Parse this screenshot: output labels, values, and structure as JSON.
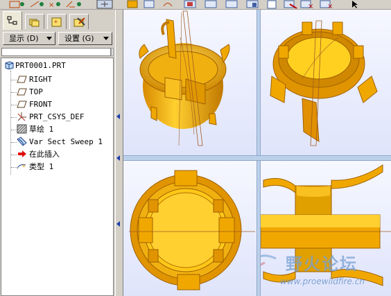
{
  "toolbar": {
    "icons": [
      "datum-plane-display-icon",
      "datum-axis-display-icon",
      "point-display-icon",
      "csys-display-icon",
      "spin-center-icon",
      "view-icon",
      "view-icon",
      "view-icon",
      "view-icon",
      "view-icon",
      "view-icon",
      "view-icon",
      "view-icon",
      "view-icon",
      "view-icon",
      "cursor-icon"
    ]
  },
  "tabs": [
    {
      "name": "model-tree-tab",
      "active": true
    },
    {
      "name": "folder-browser-tab",
      "active": false
    },
    {
      "name": "favorites-tab",
      "active": false
    },
    {
      "name": "connections-tab",
      "active": false
    }
  ],
  "menus": {
    "show_label": "显示 (D)",
    "settings_label": "设置 (G)"
  },
  "tree": {
    "root": "PRT0001.PRT",
    "items": [
      {
        "label": "RIGHT",
        "icon": "datum-plane-icon"
      },
      {
        "label": "TOP",
        "icon": "datum-plane-icon"
      },
      {
        "label": "FRONT",
        "icon": "datum-plane-icon"
      },
      {
        "label": "PRT_CSYS_DEF",
        "icon": "csys-icon"
      },
      {
        "label": "草绘 1",
        "icon": "sketch-icon"
      },
      {
        "label": "Var Sect Sweep 1",
        "icon": "sweep-icon"
      },
      {
        "label": "在此插入",
        "icon": "insert-here-arrow-icon"
      },
      {
        "label": "类型 1",
        "icon": "style-feature-icon"
      }
    ]
  },
  "colors": {
    "part": "#f0a800",
    "part_dark": "#b06a00",
    "part_light": "#ffd840",
    "viewport_bg": "#eef0ff",
    "divider": "#bcd0ea"
  },
  "watermark": {
    "cn": "野火论坛",
    "url": "www.proewildfire.cn"
  }
}
